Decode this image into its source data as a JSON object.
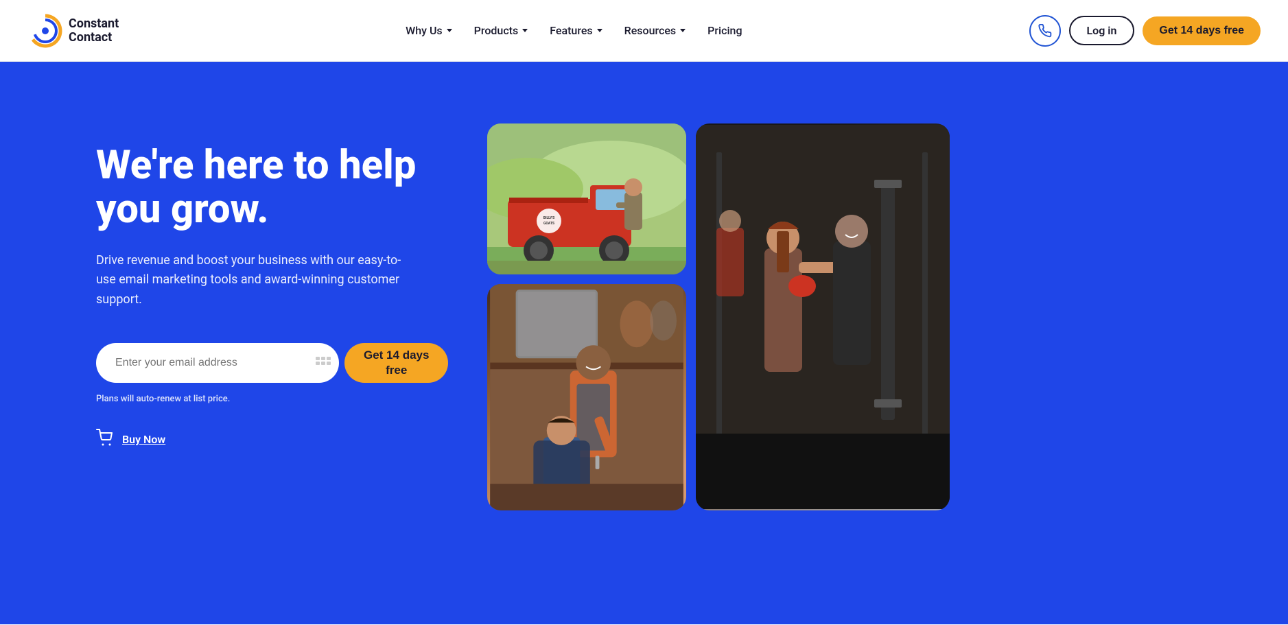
{
  "logo": {
    "line1": "Constant",
    "line2": "Contact",
    "alt": "Constant Contact logo"
  },
  "nav": {
    "items": [
      {
        "label": "Why Us",
        "hasDropdown": true
      },
      {
        "label": "Products",
        "hasDropdown": true
      },
      {
        "label": "Features",
        "hasDropdown": true
      },
      {
        "label": "Resources",
        "hasDropdown": true
      },
      {
        "label": "Pricing",
        "hasDropdown": false
      }
    ]
  },
  "actions": {
    "phone_aria": "Call us",
    "login_label": "Log in",
    "cta_label": "Get 14 days free"
  },
  "hero": {
    "title": "We're here to help you grow.",
    "subtitle": "Drive revenue and boost your business with our easy-to-use email marketing tools and award-winning customer support.",
    "email_placeholder": "Enter your email address",
    "cta_label": "Get 14 days\nfree",
    "disclaimer": "Plans will auto-renew at list price.",
    "buy_now_label": "Buy Now"
  }
}
